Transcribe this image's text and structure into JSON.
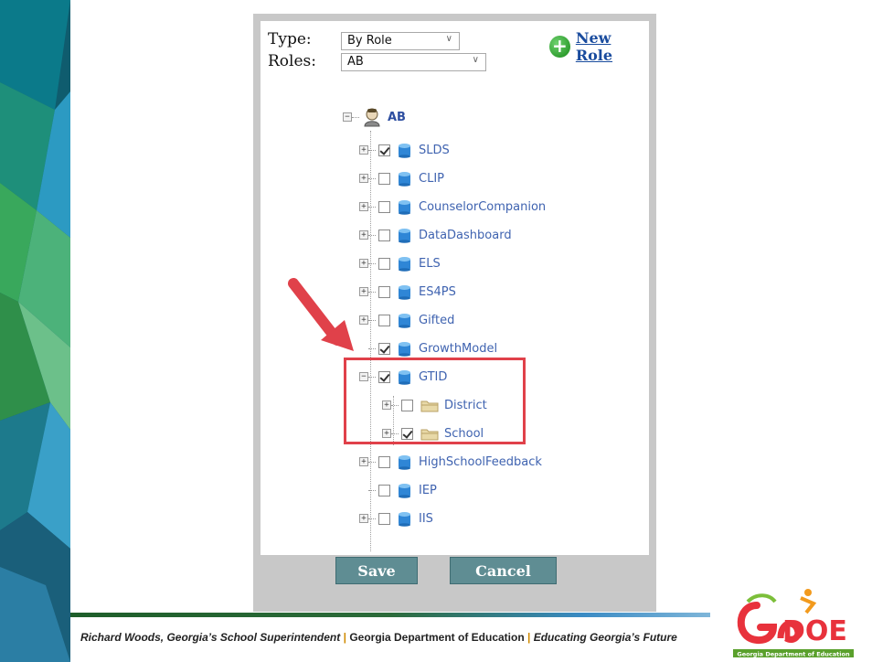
{
  "form": {
    "type_label": "Type:",
    "type_value": "By Role",
    "roles_label": "Roles:",
    "roles_value": "AB",
    "new_role_label": "New Role"
  },
  "tree": {
    "root": "AB",
    "items": [
      {
        "label": "SLDS",
        "checked": true,
        "expandable": true
      },
      {
        "label": "CLIP",
        "checked": false,
        "expandable": true
      },
      {
        "label": "CounselorCompanion",
        "checked": false,
        "expandable": true
      },
      {
        "label": "DataDashboard",
        "checked": false,
        "expandable": true
      },
      {
        "label": "ELS",
        "checked": false,
        "expandable": true
      },
      {
        "label": "ES4PS",
        "checked": false,
        "expandable": true
      },
      {
        "label": "Gifted",
        "checked": false,
        "expandable": true
      },
      {
        "label": "GrowthModel",
        "checked": true,
        "expandable": false
      },
      {
        "label": "GTID",
        "checked": true,
        "expandable": true,
        "expanded": true
      },
      {
        "label": "District",
        "checked": false,
        "expandable": true,
        "child": true
      },
      {
        "label": "School",
        "checked": true,
        "expandable": true,
        "child": true
      },
      {
        "label": "HighSchoolFeedback",
        "checked": false,
        "expandable": true
      },
      {
        "label": "IEP",
        "checked": false,
        "expandable": false
      },
      {
        "label": "IIS",
        "checked": false,
        "expandable": true
      }
    ]
  },
  "buttons": {
    "save": "Save",
    "cancel": "Cancel"
  },
  "footer": {
    "superintendent": "Richard Woods, Georgia’s School Superintendent",
    "separator": "|",
    "department": "Georgia Department of Education",
    "tagline": "Educating Georgia’s Future"
  },
  "logo": {
    "text": "GaDOE",
    "subtext": "Georgia Department of Education"
  },
  "colors": {
    "highlight": "#e0414a",
    "button": "#5f8d93",
    "link": "#1a4c9e",
    "tree_text": "#3f63b0"
  }
}
